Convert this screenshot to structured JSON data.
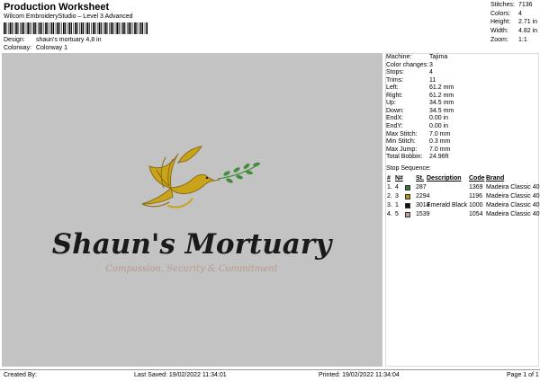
{
  "header": {
    "title": "Production Worksheet",
    "subtitle": "Wilcom EmbroideryStudio – Level 3 Advanced",
    "design_label": "Design:",
    "design_value": "shaun's mortuary 4,8 in",
    "colorway_label": "Colorway:",
    "colorway_value": "Colorway 1"
  },
  "stats": [
    {
      "label": "Stitches:",
      "value": "7136"
    },
    {
      "label": "Colors:",
      "value": "4"
    },
    {
      "label": "Height:",
      "value": "2.71 in"
    },
    {
      "label": "Width:",
      "value": "4.82 in"
    },
    {
      "label": "Zoom:",
      "value": "1:1"
    }
  ],
  "machine_info": [
    {
      "label": "Machine:",
      "value": "Tajima"
    },
    {
      "label": "Color changes:",
      "value": "3"
    },
    {
      "label": "Stops:",
      "value": "4"
    },
    {
      "label": "Trims:",
      "value": "11"
    },
    {
      "label": "Left:",
      "value": "61.2 mm"
    },
    {
      "label": "Right:",
      "value": "61.2 mm"
    },
    {
      "label": "Up:",
      "value": "34.5 mm"
    },
    {
      "label": "Down:",
      "value": "34.5 mm"
    },
    {
      "label": "EndX:",
      "value": "0.00 in"
    },
    {
      "label": "EndY:",
      "value": "0.00 in"
    },
    {
      "label": "Max Stitch:",
      "value": "7.0 mm"
    },
    {
      "label": "Min Stitch:",
      "value": "0.3 mm"
    },
    {
      "label": "Max Jump:",
      "value": "7.0 mm"
    },
    {
      "label": "Total Bobbin:",
      "value": "24.96ft"
    }
  ],
  "stop_sequence": {
    "title": "Stop Sequence:",
    "headers": {
      "num": "#",
      "n": "N#",
      "st": "St.",
      "description": "Description",
      "code": "Code",
      "brand": "Brand"
    },
    "rows": [
      {
        "num": "1.",
        "n": "4",
        "color": "#2e7d32",
        "st": "287",
        "description": "",
        "code": "1369",
        "brand": "Madeira Classic 40"
      },
      {
        "num": "2.",
        "n": "3",
        "color": "#b8960c",
        "st": "2294",
        "description": "",
        "code": "1196",
        "brand": "Madeira Classic 40"
      },
      {
        "num": "3.",
        "n": "1",
        "color": "#111111",
        "st": "3014",
        "description": "Emerald Black",
        "code": "1000",
        "brand": "Madeira Classic 40"
      },
      {
        "num": "4.",
        "n": "5",
        "color": "#c4a090",
        "st": "1539",
        "description": "",
        "code": "1054",
        "brand": "Madeira Classic 40"
      }
    ]
  },
  "design": {
    "name_text": "Shaun's Mortuary",
    "tagline": "Compassion, Security & Commitment",
    "colors": {
      "gold": "#c9a41a",
      "gold_dark": "#8a6d10",
      "leaf": "#3e8e3a",
      "text": "#1a1a1a",
      "tagline": "#b89a8a"
    }
  },
  "footer": {
    "created_by": "Created By:",
    "last_saved": "Last Saved: 19/02/2022 11:34:01",
    "printed": "Printed: 19/02/2022 11:34:04",
    "page": "Page 1 of 1"
  }
}
